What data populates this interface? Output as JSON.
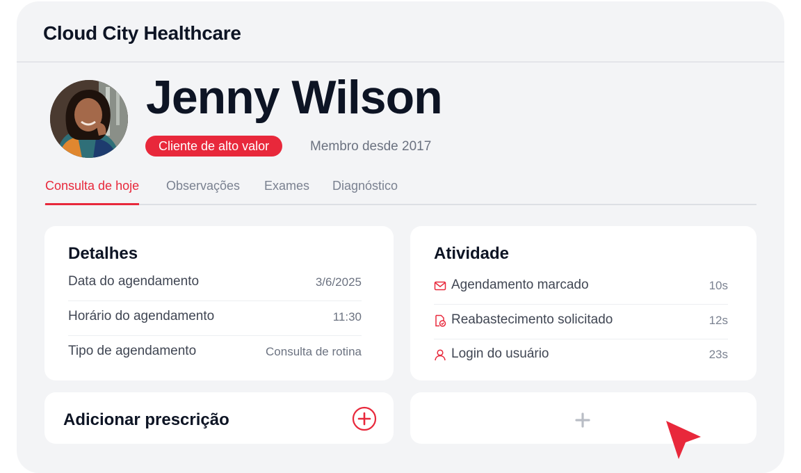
{
  "app": {
    "title": "Cloud City Healthcare"
  },
  "patient": {
    "name": "Jenny Wilson",
    "badge": "Cliente de alto valor",
    "member_since": "Membro desde 2017"
  },
  "tabs": [
    {
      "label": "Consulta de hoje",
      "active": true
    },
    {
      "label": "Observações",
      "active": false
    },
    {
      "label": "Exames",
      "active": false
    },
    {
      "label": "Diagnóstico",
      "active": false
    }
  ],
  "details": {
    "title": "Detalhes",
    "rows": [
      {
        "label": "Data do agendamento",
        "value": "3/6/2025"
      },
      {
        "label": "Horário do agendamento",
        "value": "11:30"
      },
      {
        "label": "Tipo de agendamento",
        "value": "Consulta de rotina"
      }
    ]
  },
  "activity": {
    "title": "Atividade",
    "items": [
      {
        "icon": "envelope-icon",
        "label": "Agendamento marcado",
        "time": "10s"
      },
      {
        "icon": "document-check-icon",
        "label": "Reabastecimento solicitado",
        "time": "12s"
      },
      {
        "icon": "user-icon",
        "label": "Login do usuário",
        "time": "23s"
      }
    ]
  },
  "prescription": {
    "label": "Adicionar prescrição"
  },
  "colors": {
    "accent": "#e8283b",
    "text_dark": "#0d1424",
    "text_muted": "#6b7280",
    "background": "#f3f4f6",
    "card": "#ffffff"
  }
}
